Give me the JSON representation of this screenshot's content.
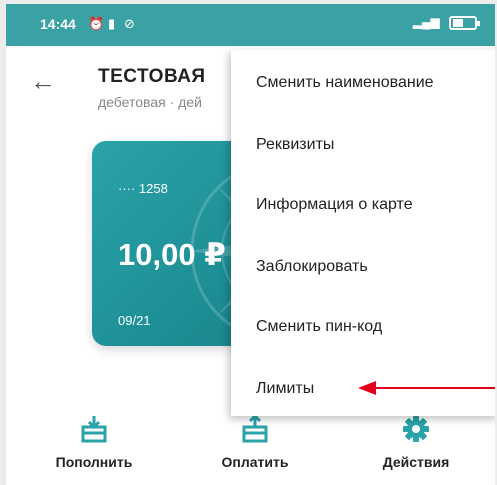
{
  "status_bar": {
    "time": "14:44",
    "icons": [
      "alarm-icon",
      "lock-icon",
      "do-not-disturb-icon",
      "signal-icon",
      "battery-icon"
    ],
    "battery_label": "55"
  },
  "header": {
    "title": "ТЕСТОВАЯ",
    "subtitle": "дебетовая · дей"
  },
  "card": {
    "number": "···· 1258",
    "balance": "10,00 ₽",
    "expiry": "09/21"
  },
  "menu": {
    "items": [
      {
        "label": "Сменить наименование"
      },
      {
        "label": "Реквизиты"
      },
      {
        "label": "Информация о карте"
      },
      {
        "label": "Заблокировать"
      },
      {
        "label": "Сменить пин-код"
      },
      {
        "label": "Лимиты"
      }
    ]
  },
  "actions": {
    "topup_label": "Пополнить",
    "pay_label": "Оплатить",
    "actions_label": "Действия"
  },
  "colors": {
    "status_bar": "#3aa2a5",
    "accent": "#2aa3a8",
    "annotation": "#e5001b"
  }
}
